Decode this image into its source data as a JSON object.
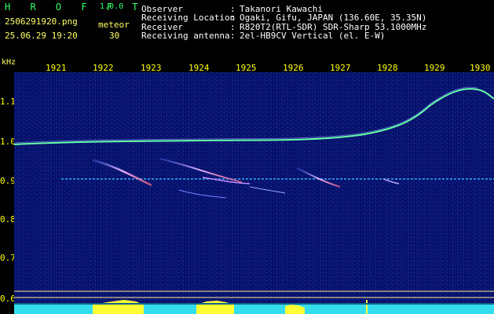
{
  "header": {
    "app_name": "H R O F F T",
    "version": "1.0.0",
    "filename": "2506291920.png",
    "datetime": "25.06.29 19:20",
    "meteor_label": "meteor",
    "meteor_count": "30",
    "info": [
      {
        "label": "Observer",
        "sep": ":",
        "value": "Takanori Kawachi"
      },
      {
        "label": "Receiving Location",
        "sep": ":",
        "value": "Ogaki, Gifu, JAPAN (136.60E, 35.35N)"
      },
      {
        "label": "Receiver",
        "sep": ":",
        "value": "R820T2(RTL-SDR) SDR-Sharp 53.1000MHz"
      },
      {
        "label": "Receiving antenna",
        "sep": ":",
        "value": "2el-HB9CV Vertical (el. E-W)"
      }
    ]
  },
  "axis": {
    "unit": "kHz",
    "x_ticks": [
      "1921",
      "1922",
      "1923",
      "1924",
      "1925",
      "1926",
      "1927",
      "1928",
      "1929",
      "1930"
    ],
    "y_ticks": [
      "1.1",
      "1.0",
      "0.9",
      "0.8",
      "0.7",
      "0.6"
    ]
  },
  "colors": {
    "background": "#000000",
    "noise": "#0a1880",
    "carrier": "#66ffaa",
    "meteor": "#d0a0ff",
    "labels": "#ffff00",
    "level_bar": "#33ddee",
    "level_peak": "#ffff33"
  }
}
